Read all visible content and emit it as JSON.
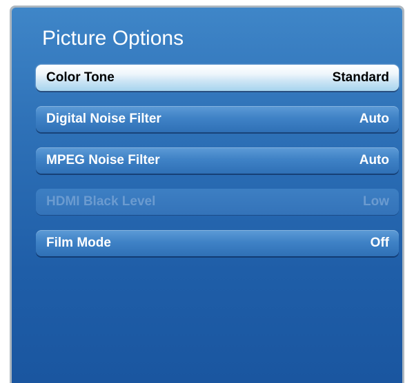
{
  "panel": {
    "title": "Picture Options"
  },
  "menu": {
    "items": [
      {
        "label": "Color Tone",
        "value": "Standard",
        "state": "selected"
      },
      {
        "label": "Digital Noise Filter",
        "value": "Auto",
        "state": "normal"
      },
      {
        "label": "MPEG Noise Filter",
        "value": "Auto",
        "state": "normal"
      },
      {
        "label": "HDMI Black Level",
        "value": "Low",
        "state": "disabled"
      },
      {
        "label": "Film Mode",
        "value": "Off",
        "state": "normal"
      }
    ]
  },
  "colors": {
    "panel_top": "#3f86c8",
    "panel_bottom": "#1a56a0",
    "selected_highlight": "#a6d4ee",
    "disabled_text": "#6b9bd0"
  }
}
